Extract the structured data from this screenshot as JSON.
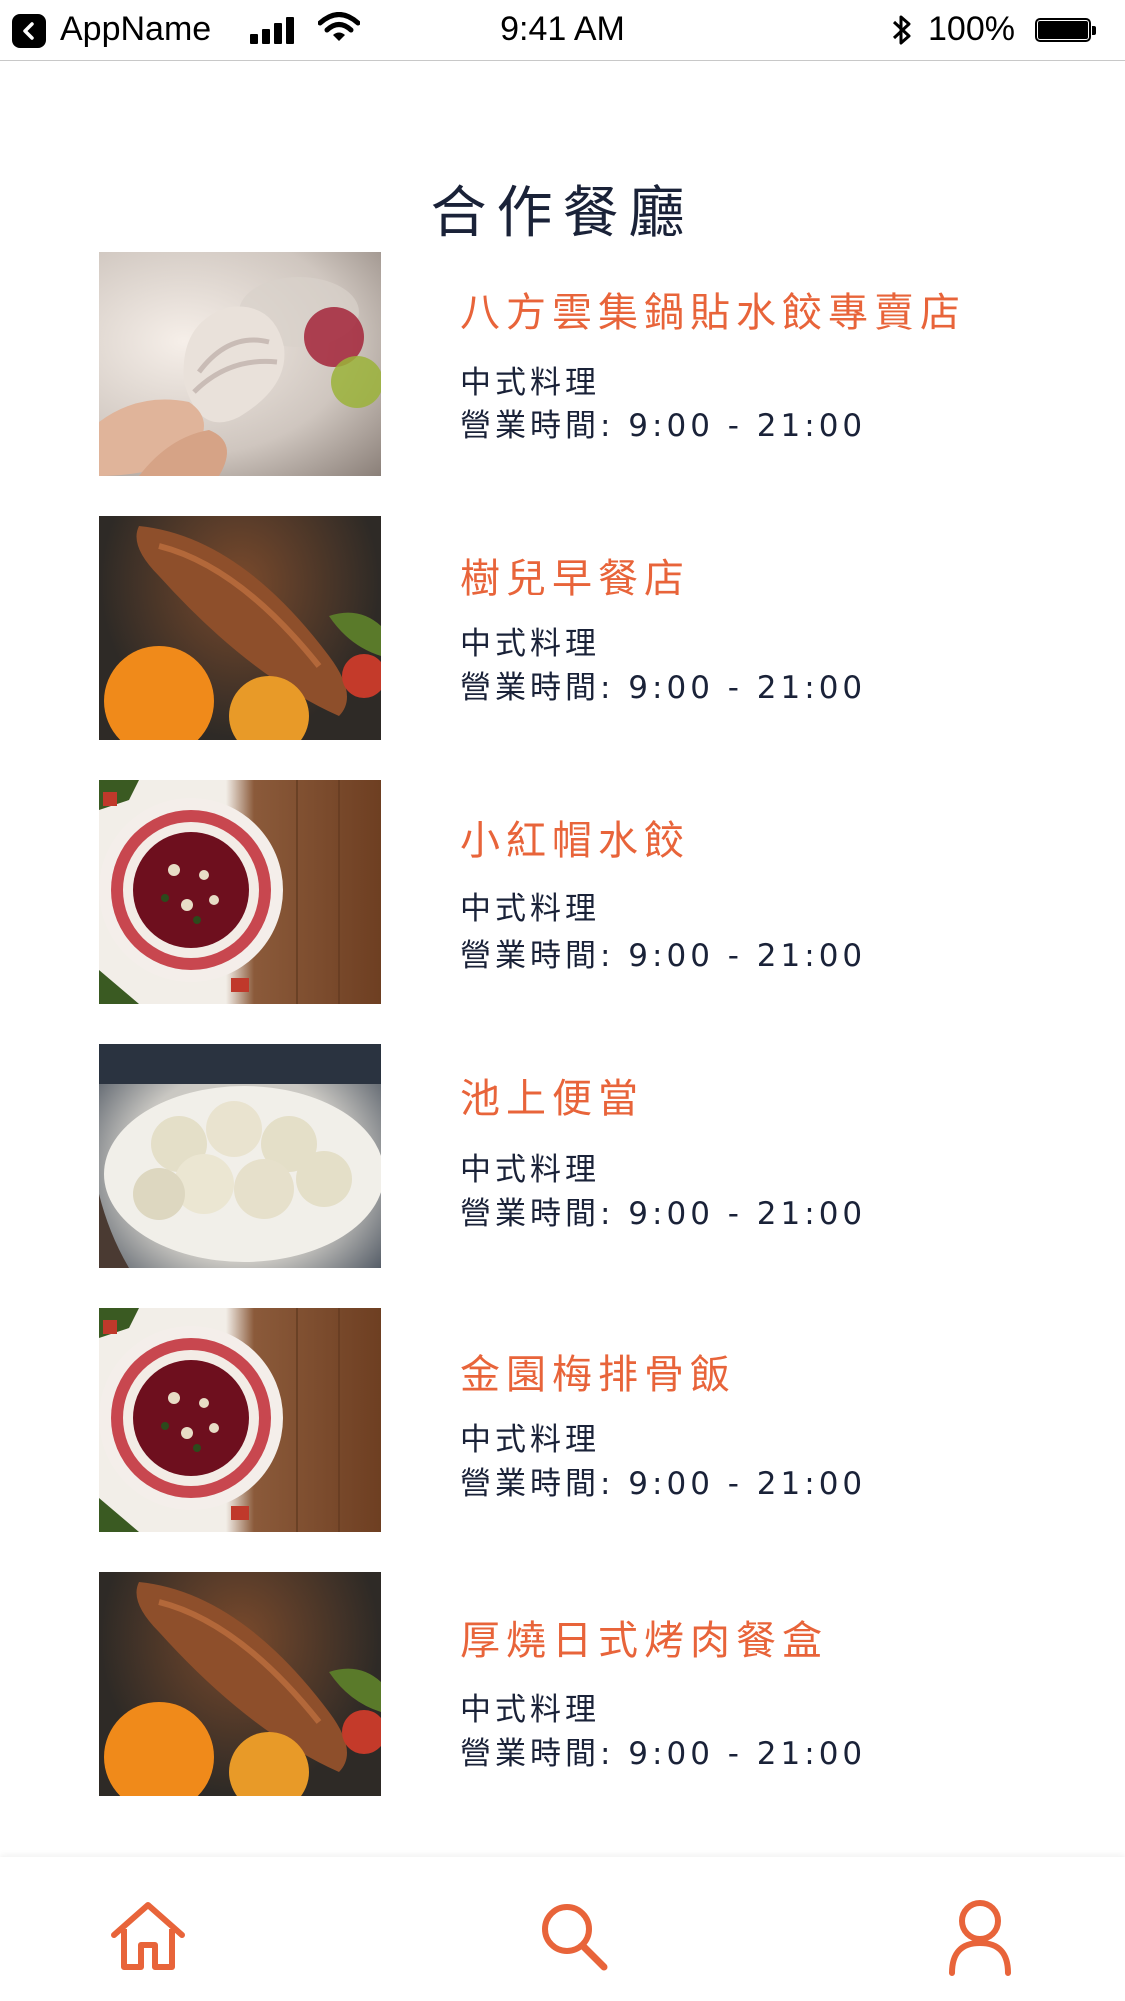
{
  "status_bar": {
    "app_name": "AppName",
    "time": "9:41 AM",
    "battery": "100%"
  },
  "page": {
    "title": "合作餐廳"
  },
  "restaurants": [
    {
      "name": "八方雲集鍋貼水餃專賣店",
      "type": "中式料理",
      "hours": "營業時間: 9:00 - 21:00",
      "image": "dumpling-hand"
    },
    {
      "name": "樹兒早餐店",
      "type": "中式料理",
      "hours": "營業時間: 9:00 - 21:00",
      "image": "meat"
    },
    {
      "name": "小紅帽水餃",
      "type": "中式料理",
      "hours": "營業時間: 9:00 - 21:00",
      "image": "borscht"
    },
    {
      "name": "池上便當",
      "type": "中式料理",
      "hours": "營業時間: 9:00 - 21:00",
      "image": "dumpling-plate"
    },
    {
      "name": "金園梅排骨飯",
      "type": "中式料理",
      "hours": "營業時間: 9:00 - 21:00",
      "image": "borscht"
    },
    {
      "name": "厚燒日式烤肉餐盒",
      "type": "中式料理",
      "hours": "營業時間: 9:00 - 21:00",
      "image": "meat"
    }
  ],
  "tabbar": {
    "items": [
      "home-icon",
      "search-icon",
      "user-icon"
    ]
  },
  "colors": {
    "accent": "#e8643a",
    "text": "#1a2238"
  }
}
